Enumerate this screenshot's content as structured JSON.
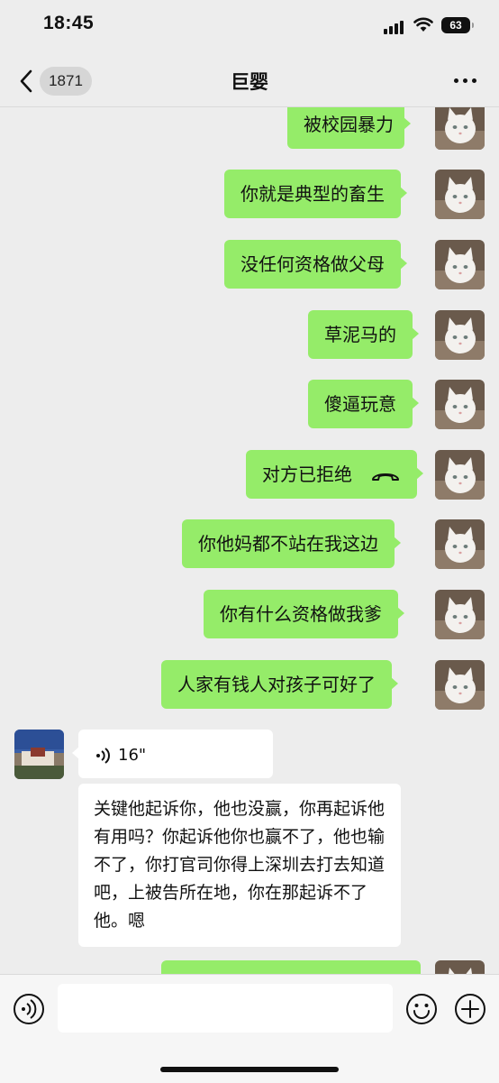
{
  "status_bar": {
    "time": "18:45",
    "battery": "63"
  },
  "nav": {
    "back_count": "1871",
    "title": "巨婴"
  },
  "messages": [
    {
      "side": "right",
      "text": "被校园暴力"
    },
    {
      "side": "right",
      "text": "你就是典型的畜生"
    },
    {
      "side": "right",
      "text": "没任何资格做父母"
    },
    {
      "side": "right",
      "text": "草泥马的"
    },
    {
      "side": "right",
      "text": "傻逼玩意"
    },
    {
      "side": "right",
      "text": "对方已拒绝",
      "icon": "phone-hangup-icon"
    },
    {
      "side": "right",
      "text": "你他妈都不站在我这边"
    },
    {
      "side": "right",
      "text": "你有什么资格做我爹"
    },
    {
      "side": "right",
      "text": "人家有钱人对孩子可好了"
    }
  ],
  "incoming": {
    "voice_duration": "16\"",
    "text": "关键他起诉你，他也没赢，你再起诉他有用吗？你起诉他你也赢不了，他也输不了，你打官司你得上深圳去打去知道吧，上被告所在地，你在那起诉不了他。嗯"
  },
  "colors": {
    "my_bubble": "#95ec69",
    "background": "#ededed"
  },
  "input_bar": {
    "icons": [
      "voice-icon",
      "emoji-icon",
      "plus-icon"
    ]
  }
}
